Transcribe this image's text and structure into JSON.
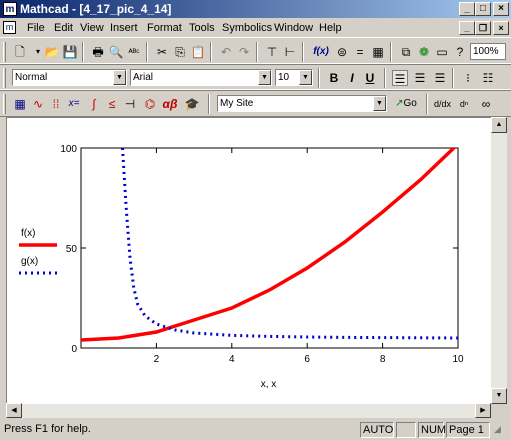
{
  "window": {
    "title": "Mathcad - [4_17_pic_4_14]",
    "minimize": "_",
    "maximize": "□",
    "close": "×"
  },
  "menu": {
    "items": [
      "File",
      "Edit",
      "View",
      "Insert",
      "Format",
      "Tools",
      "Symbolics",
      "Window",
      "Help"
    ],
    "doc_minimize": "_",
    "doc_restore": "❐",
    "doc_close": "×"
  },
  "toolbar_standard": {
    "zoom": "100%",
    "function_label": "f(x)"
  },
  "toolbar_format": {
    "style": "Normal",
    "font": "Arial",
    "size": "10",
    "bold": "B",
    "italic": "I",
    "underline": "U"
  },
  "toolbar_math": {
    "site": "My Site",
    "go": "Go"
  },
  "plot": {
    "legend": [
      {
        "label": "f(x)",
        "color": "#ff0000",
        "style": "solid"
      },
      {
        "label": "g(x)",
        "color": "#0000cc",
        "style": "dotted"
      }
    ],
    "xlabel": "x, x"
  },
  "chart_data": {
    "type": "line",
    "title": "",
    "xlabel": "x, x",
    "ylabel": "",
    "xlim": [
      0,
      10
    ],
    "ylim": [
      0,
      100
    ],
    "xticks": [
      2,
      4,
      6,
      8,
      10
    ],
    "yticks": [
      0,
      50,
      100
    ],
    "grid": false,
    "legend": "left",
    "series": [
      {
        "name": "f(x)",
        "color": "#ff0000",
        "style": "solid",
        "x": [
          0,
          1,
          2,
          3,
          4,
          5,
          6,
          7,
          8,
          9,
          10
        ],
        "y": [
          4,
          5,
          8,
          14,
          20,
          29,
          40,
          53,
          68,
          84,
          102
        ]
      },
      {
        "name": "g(x)",
        "color": "#0000cc",
        "style": "dotted",
        "x": [
          1.1,
          1.2,
          1.3,
          1.4,
          1.5,
          1.7,
          2,
          2.5,
          3,
          4,
          5,
          6,
          7,
          8,
          9,
          10
        ],
        "y": [
          100,
          70,
          45,
          30,
          22,
          16,
          12,
          9,
          7.5,
          6.3,
          5.8,
          5.5,
          5.3,
          5.2,
          5.1,
          5.0
        ]
      }
    ]
  },
  "status": {
    "help": "Press F1 for help.",
    "auto": "AUTO",
    "num": "NUM",
    "page": "Page 1"
  }
}
